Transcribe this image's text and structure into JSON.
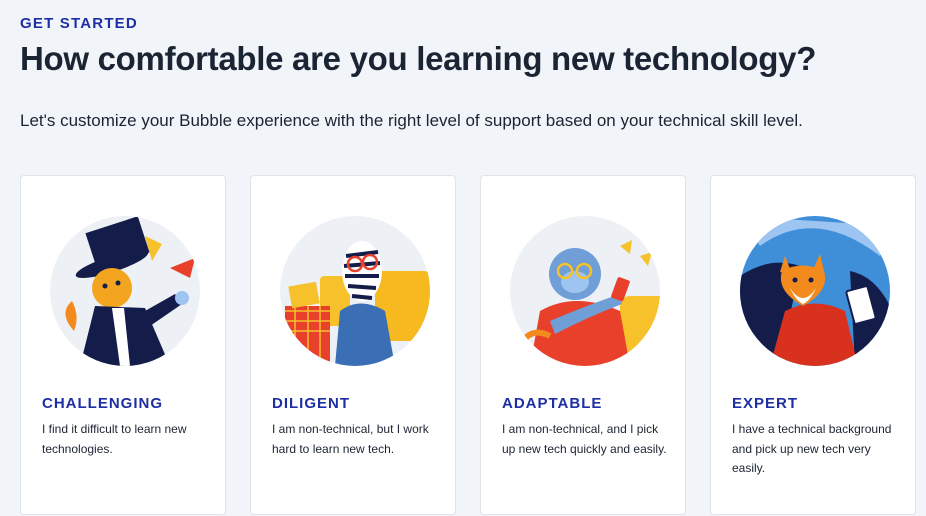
{
  "header": {
    "eyebrow": "GET STARTED",
    "title": "How comfortable are you learning new technology?",
    "subtitle": "Let's customize your Bubble experience with the right level of support based on your technical skill level."
  },
  "options": [
    {
      "label": "CHALLENGING",
      "description": "I find it difficult to learn new technologies.",
      "illustration": "magician-cat-illustration"
    },
    {
      "label": "DILIGENT",
      "description": "I am non-technical, but I work hard to learn new tech.",
      "illustration": "zebra-reading-illustration"
    },
    {
      "label": "ADAPTABLE",
      "description": "I am non-technical, and I pick up new tech quickly and easily.",
      "illustration": "monkey-phone-illustration"
    },
    {
      "label": "EXPERT",
      "description": "I have a technical background and pick up new tech very easily.",
      "illustration": "fox-laptop-illustration"
    }
  ],
  "colors": {
    "accent": "#1e2fa3",
    "background": "#f1f4f9",
    "card": "#ffffff"
  }
}
